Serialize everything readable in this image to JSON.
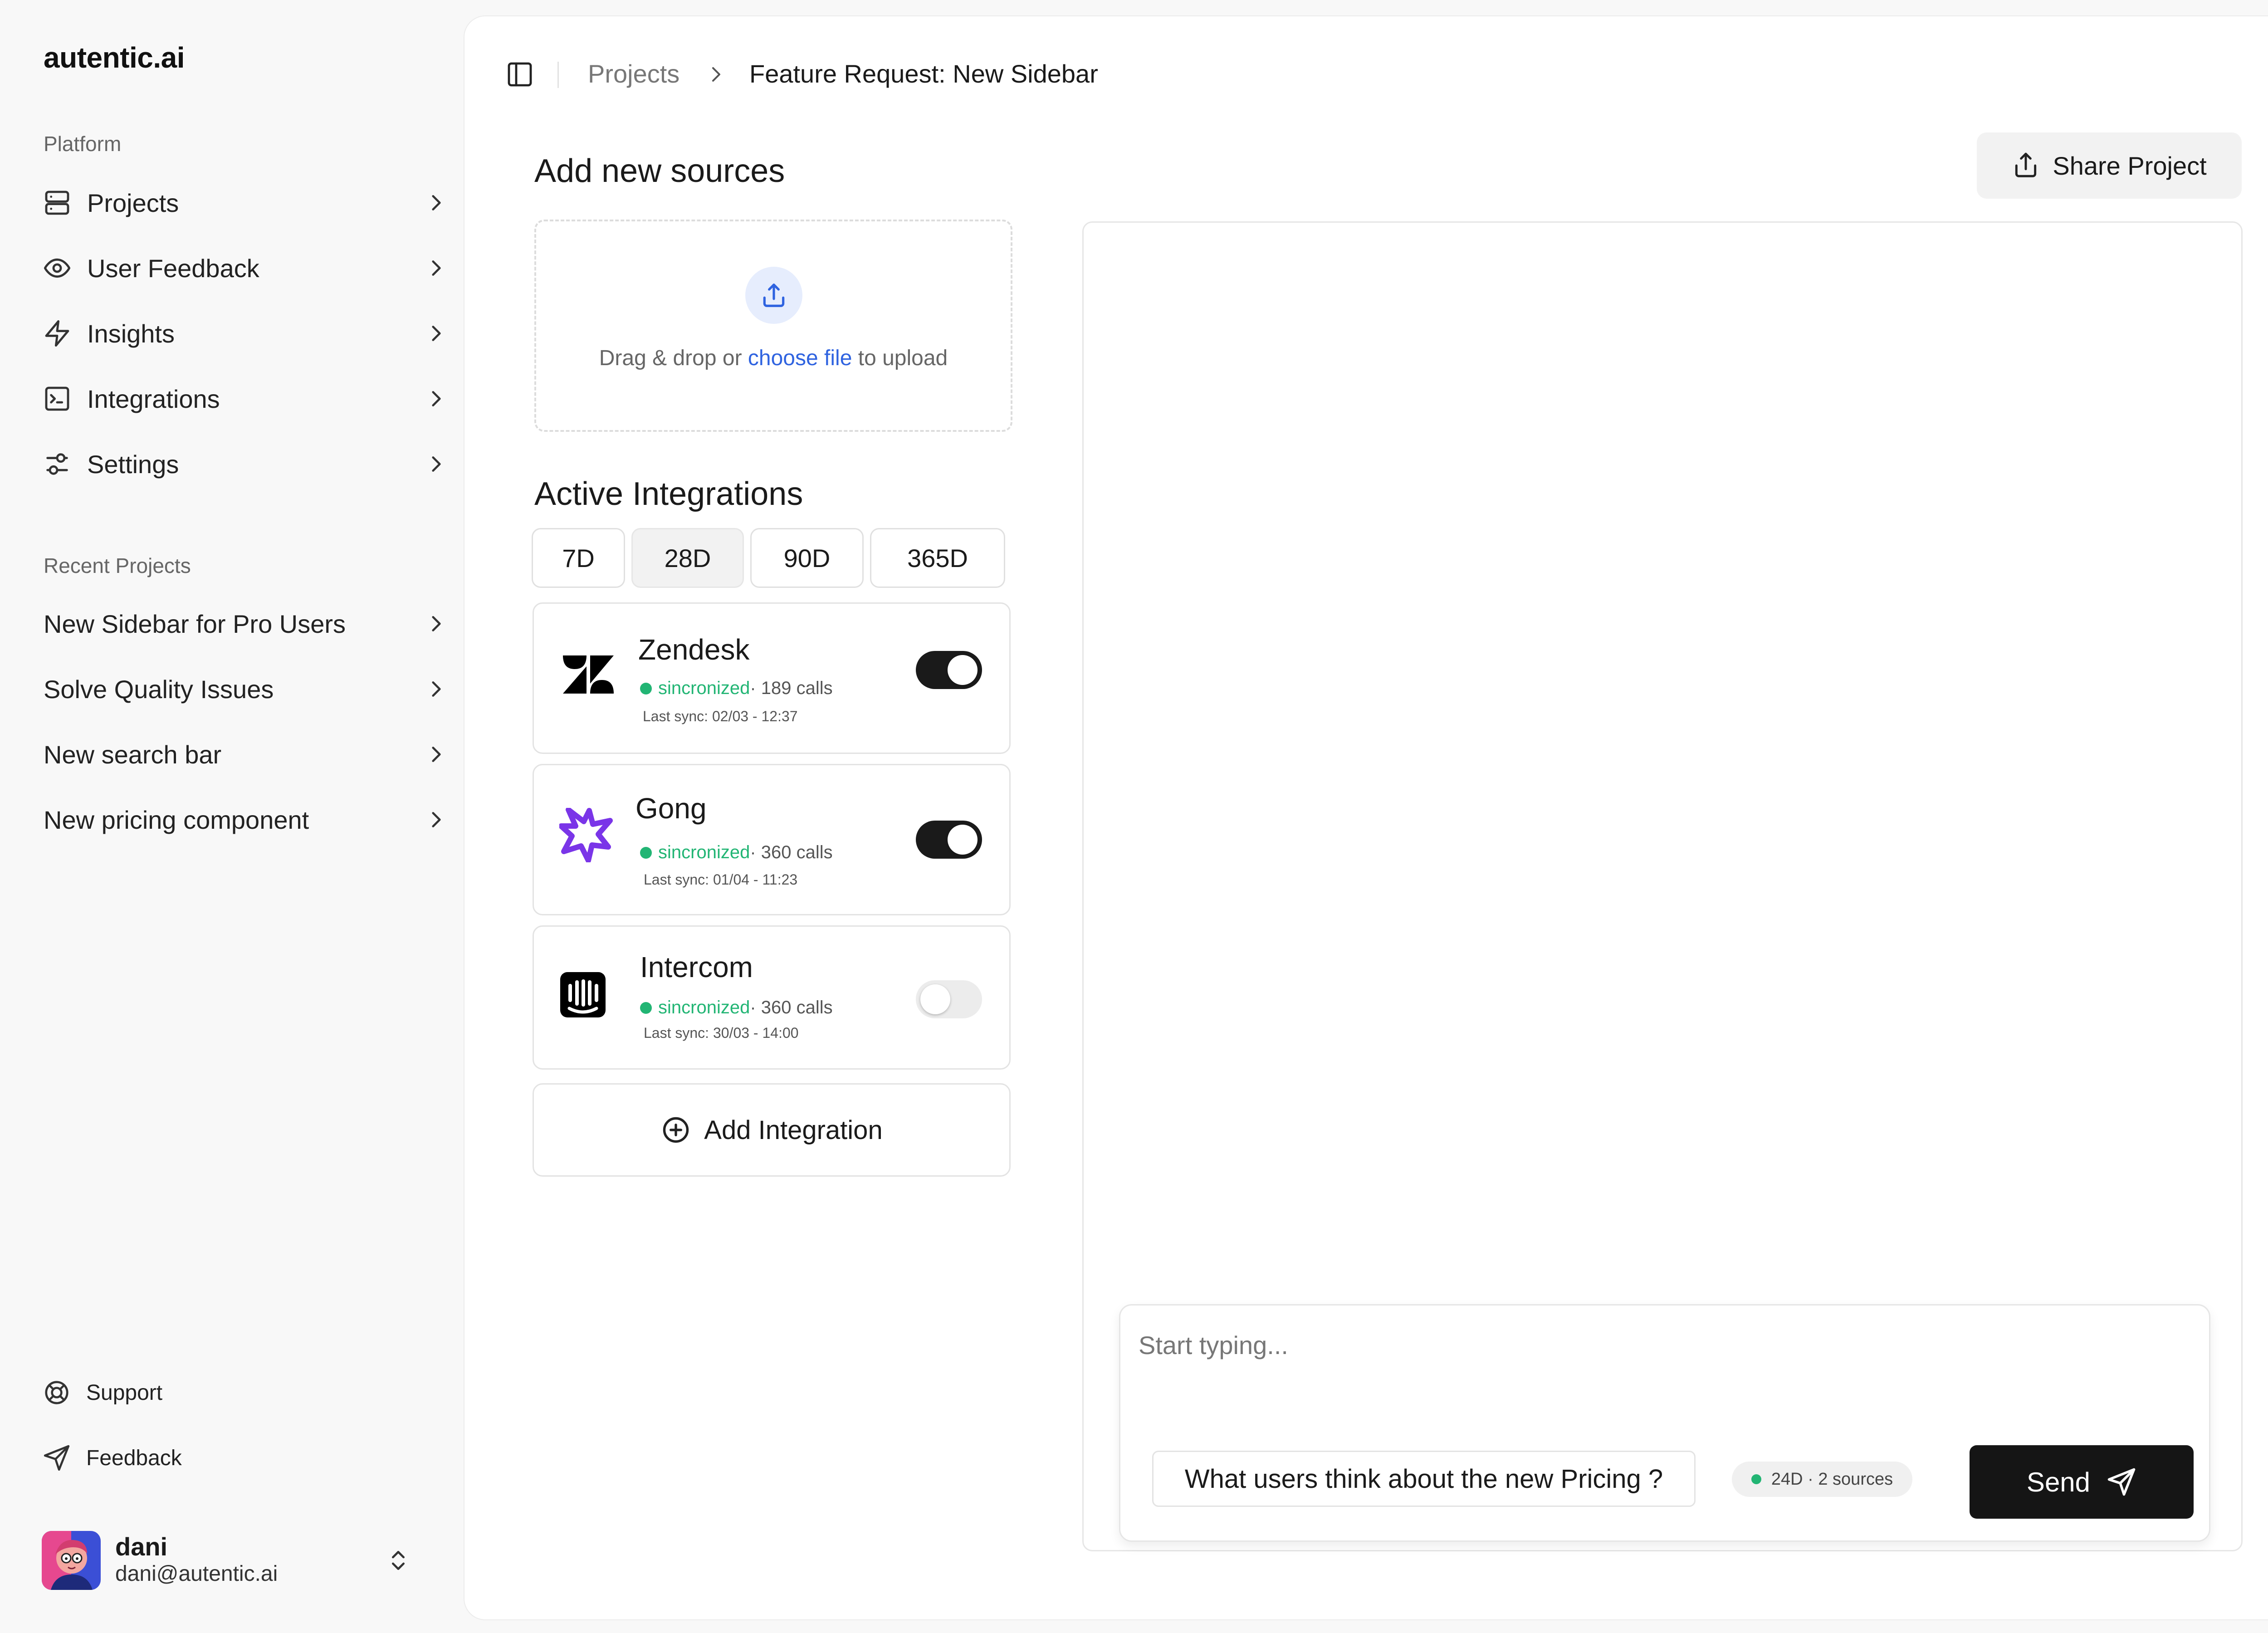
{
  "brand": "autentic.ai",
  "sidebar": {
    "platform_label": "Platform",
    "nav": [
      {
        "label": "Projects",
        "icon": "server-icon"
      },
      {
        "label": "User Feedback",
        "icon": "eye-icon"
      },
      {
        "label": "Insights",
        "icon": "lightning-icon"
      },
      {
        "label": "Integrations",
        "icon": "terminal-square-icon"
      },
      {
        "label": "Settings",
        "icon": "sliders-icon"
      }
    ],
    "recent_label": "Recent Projects",
    "recent": [
      {
        "label": "New Sidebar for Pro Users"
      },
      {
        "label": "Solve Quality Issues"
      },
      {
        "label": "New search bar"
      },
      {
        "label": "New pricing component"
      }
    ],
    "footer": [
      {
        "label": "Support",
        "icon": "life-buoy-icon"
      },
      {
        "label": "Feedback",
        "icon": "send-icon"
      }
    ],
    "user": {
      "name": "dani",
      "email": "dani@autentic.ai"
    }
  },
  "breadcrumb": {
    "parent": "Projects",
    "current": "Feature Request: New Sidebar"
  },
  "share_label": "Share Project",
  "sources": {
    "title": "Add new sources",
    "drop_prefix": "Drag & drop or",
    "drop_link": "choose file",
    "drop_suffix": "to upload"
  },
  "integrations": {
    "title": "Active Integrations",
    "ranges": [
      "7D",
      "28D",
      "90D",
      "365D"
    ],
    "selected_range": "28D",
    "items": [
      {
        "name": "Zendesk",
        "status": "sincronized",
        "calls": "· 189 calls",
        "last_sync": "Last sync: 02/03 - 12:37",
        "enabled": true
      },
      {
        "name": "Gong",
        "status": "sincronized",
        "calls": "· 360 calls",
        "last_sync": "Last sync: 01/04 - 11:23",
        "enabled": true
      },
      {
        "name": "Intercom",
        "status": "sincronized",
        "calls": "· 360 calls",
        "last_sync": "Last sync: 30/03 - 14:00",
        "enabled": false
      }
    ],
    "add_label": "Add Integration"
  },
  "chat": {
    "placeholder": "Start typing...",
    "suggestion": "What users think about the new Pricing ?",
    "scope": "24D · 2 sources",
    "send_label": "Send"
  },
  "colors": {
    "accent": "#2f63e0",
    "status_green": "#22b574",
    "dark": "#151515",
    "gong_purple": "#7a35e8"
  }
}
